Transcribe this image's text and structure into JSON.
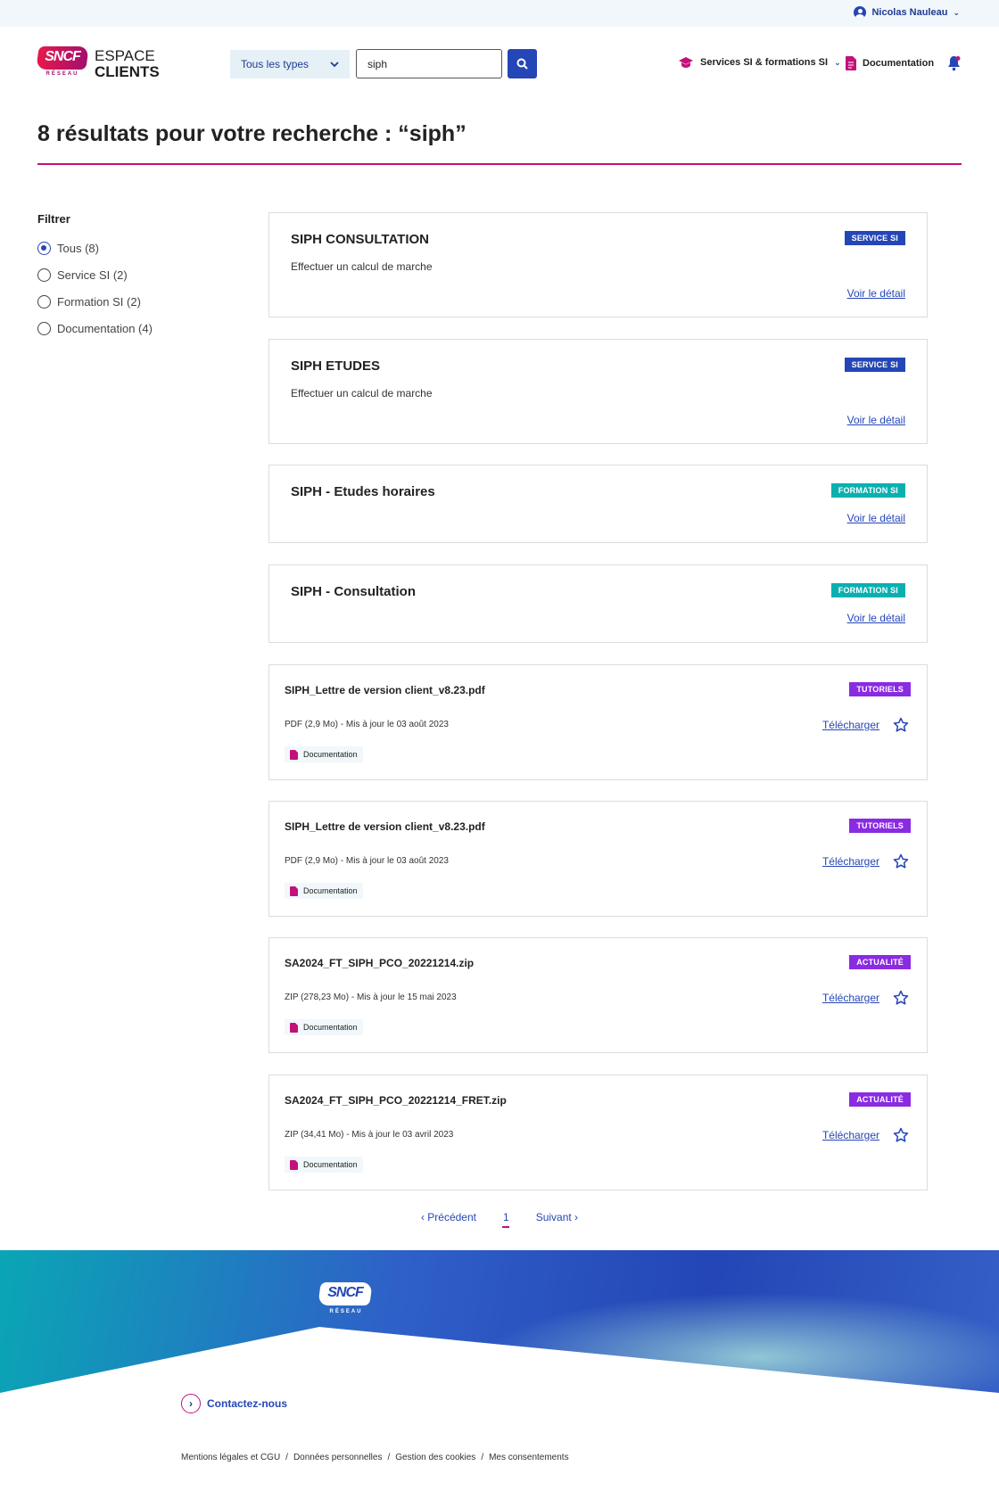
{
  "topbar": {
    "user_name": "Nicolas Nauleau"
  },
  "header": {
    "logo_brand": "SNCF",
    "logo_sub": "RÉSEAU",
    "logo_line1": "ESPACE",
    "logo_line2": "CLIENTS",
    "type_select": "Tous les types",
    "search_value": "siph",
    "nav_services": "Services SI & formations SI",
    "nav_doc": "Documentation"
  },
  "results": {
    "title": "8 résultats pour votre recherche : “siph”"
  },
  "filter": {
    "title": "Filtrer",
    "options": [
      {
        "label": "Tous (8)",
        "selected": true
      },
      {
        "label": "Service SI (2)",
        "selected": false
      },
      {
        "label": "Formation SI (2)",
        "selected": false
      },
      {
        "label": "Documentation (4)",
        "selected": false
      }
    ]
  },
  "cards": [
    {
      "title": "SIPH CONSULTATION",
      "desc": "Effectuer un calcul de marche",
      "badge": "SERVICE SI",
      "link": "Voir le détail"
    },
    {
      "title": "SIPH ETUDES",
      "desc": "Effectuer un calcul de marche",
      "badge": "SERVICE SI",
      "link": "Voir le détail"
    },
    {
      "title": "SIPH - Etudes horaires",
      "badge": "FORMATION SI",
      "link": "Voir le détail"
    },
    {
      "title": "SIPH - Consultation",
      "badge": "FORMATION SI",
      "link": "Voir le détail"
    }
  ],
  "docs": [
    {
      "title": "SIPH_Lettre de version client_v8.23.pdf",
      "meta": "PDF (2,9 Mo) - Mis à jour le 03 août 2023",
      "badge": "TUTORIELS",
      "tag": "Documentation",
      "link": "Télécharger"
    },
    {
      "title": "SIPH_Lettre de version client_v8.23.pdf",
      "meta": "PDF (2,9 Mo) - Mis à jour le 03 août 2023",
      "badge": "TUTORIELS",
      "tag": "Documentation",
      "link": "Télécharger"
    },
    {
      "title": "SA2024_FT_SIPH_PCO_20221214.zip",
      "meta": "ZIP (278,23 Mo) - Mis à jour le 15 mai 2023",
      "badge": "ACTUALITÉ",
      "tag": "Documentation",
      "link": "Télécharger"
    },
    {
      "title": "SA2024_FT_SIPH_PCO_20221214_FRET.zip",
      "meta": "ZIP (34,41 Mo) - Mis à jour le 03 avril 2023",
      "badge": "ACTUALITÉ",
      "tag": "Documentation",
      "link": "Télécharger"
    }
  ],
  "pager": {
    "prev": "‹  Précédent",
    "current": "1",
    "next": "Suivant  ›"
  },
  "footer": {
    "contact": "Contactez-nous",
    "legal": [
      "Mentions légales et CGU",
      "Données personnelles",
      "Gestion des cookies",
      "Mes consentements"
    ],
    "separator": "/"
  },
  "colors": {
    "primary": "#2446b6",
    "accent": "#c2127a",
    "teal": "#0ab0b0",
    "purple": "#8a2be2"
  }
}
